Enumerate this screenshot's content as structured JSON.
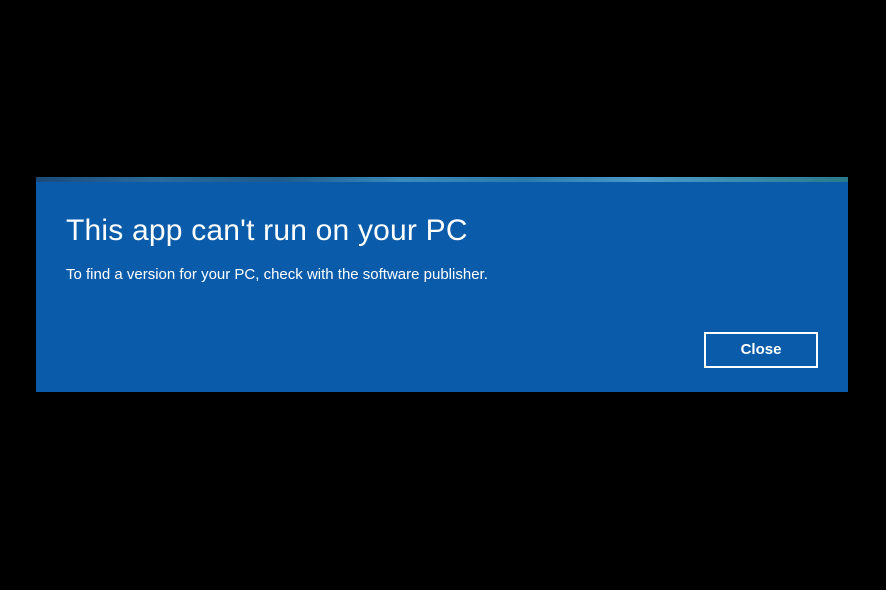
{
  "dialog": {
    "title": "This app can't run on your PC",
    "message": "To find a version for your PC, check with the software publisher.",
    "close_label": "Close"
  }
}
